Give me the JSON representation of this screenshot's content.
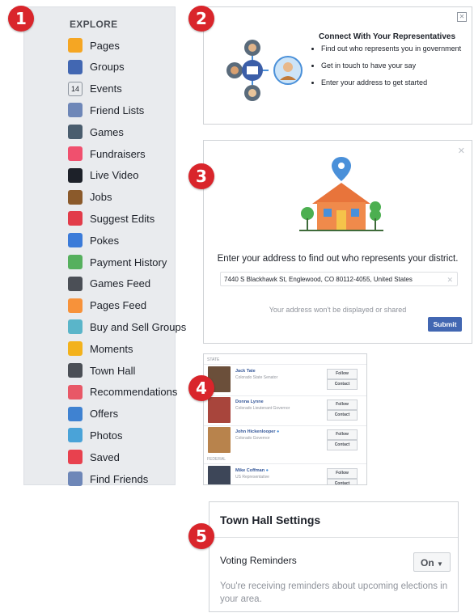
{
  "badges": [
    "1",
    "2",
    "3",
    "4",
    "5"
  ],
  "explore": {
    "header": "EXPLORE",
    "items": [
      {
        "label": "Pages",
        "icon": "flag-icon",
        "color": "#f5a623"
      },
      {
        "label": "Groups",
        "icon": "groups-icon",
        "color": "#4267b2"
      },
      {
        "label": "Events",
        "icon": "calendar-icon",
        "color": "#e9ebee",
        "glyph": "14"
      },
      {
        "label": "Friend Lists",
        "icon": "friend-list-icon",
        "color": "#6e87b8"
      },
      {
        "label": "Games",
        "icon": "games-icon",
        "color": "#4a5d6e"
      },
      {
        "label": "Fundraisers",
        "icon": "heart-icon",
        "color": "#f0506e"
      },
      {
        "label": "Live Video",
        "icon": "video-camera-icon",
        "color": "#1d2129"
      },
      {
        "label": "Jobs",
        "icon": "briefcase-icon",
        "color": "#8b5a2b"
      },
      {
        "label": "Suggest Edits",
        "icon": "map-pin-icon",
        "color": "#e23c4a"
      },
      {
        "label": "Pokes",
        "icon": "poke-icon",
        "color": "#3b7bd9"
      },
      {
        "label": "Payment History",
        "icon": "payment-history-icon",
        "color": "#56b05e"
      },
      {
        "label": "Games Feed",
        "icon": "gamepad-icon",
        "color": "#4b4f56"
      },
      {
        "label": "Pages Feed",
        "icon": "pages-feed-icon",
        "color": "#f7923a"
      },
      {
        "label": "Buy and Sell Groups",
        "icon": "tag-icon",
        "color": "#5ab5c9"
      },
      {
        "label": "Moments",
        "icon": "moments-icon",
        "color": "#f3b21c"
      },
      {
        "label": "Town Hall",
        "icon": "town-hall-icon",
        "color": "#4b4f56"
      },
      {
        "label": "Recommendations",
        "icon": "recommendations-icon",
        "color": "#e85867"
      },
      {
        "label": "Offers",
        "icon": "offers-icon",
        "color": "#3f82d1"
      },
      {
        "label": "Photos",
        "icon": "photos-icon",
        "color": "#4aa3d8"
      },
      {
        "label": "Saved",
        "icon": "bookmark-icon",
        "color": "#e8414e"
      },
      {
        "label": "Find Friends",
        "icon": "find-friends-icon",
        "color": "#6e87b8"
      }
    ]
  },
  "connect": {
    "title": "Connect With Your Representatives",
    "bullets": [
      "Find out who represents you in government",
      "Get in touch to have your say",
      "Enter your address to get started"
    ]
  },
  "address": {
    "prompt": "Enter your address to find out who represents your district.",
    "value": "7440 S Blackhawk St, Englewood, CO 80112-4055, United States",
    "note": "Your address won't be displayed or shared",
    "submit": "Submit"
  },
  "reps": {
    "state_label": "STATE",
    "federal_label": "FEDERAL",
    "follow": "Follow",
    "contact": "Contact",
    "state": [
      {
        "name": "Jack Tate",
        "role": "Colorado State Senator"
      },
      {
        "name": "Donna Lynne",
        "role": "Colorado Lieutenant Governor"
      },
      {
        "name": "John Hickenlooper",
        "role": "Colorado Governor"
      }
    ],
    "federal": [
      {
        "name": "Mike Coffman",
        "role": "US Representative"
      }
    ]
  },
  "settings": {
    "title": "Town Hall Settings",
    "voting_label": "Voting Reminders",
    "toggle": "On",
    "description": "You're receiving reminders about upcoming elections in your area."
  }
}
